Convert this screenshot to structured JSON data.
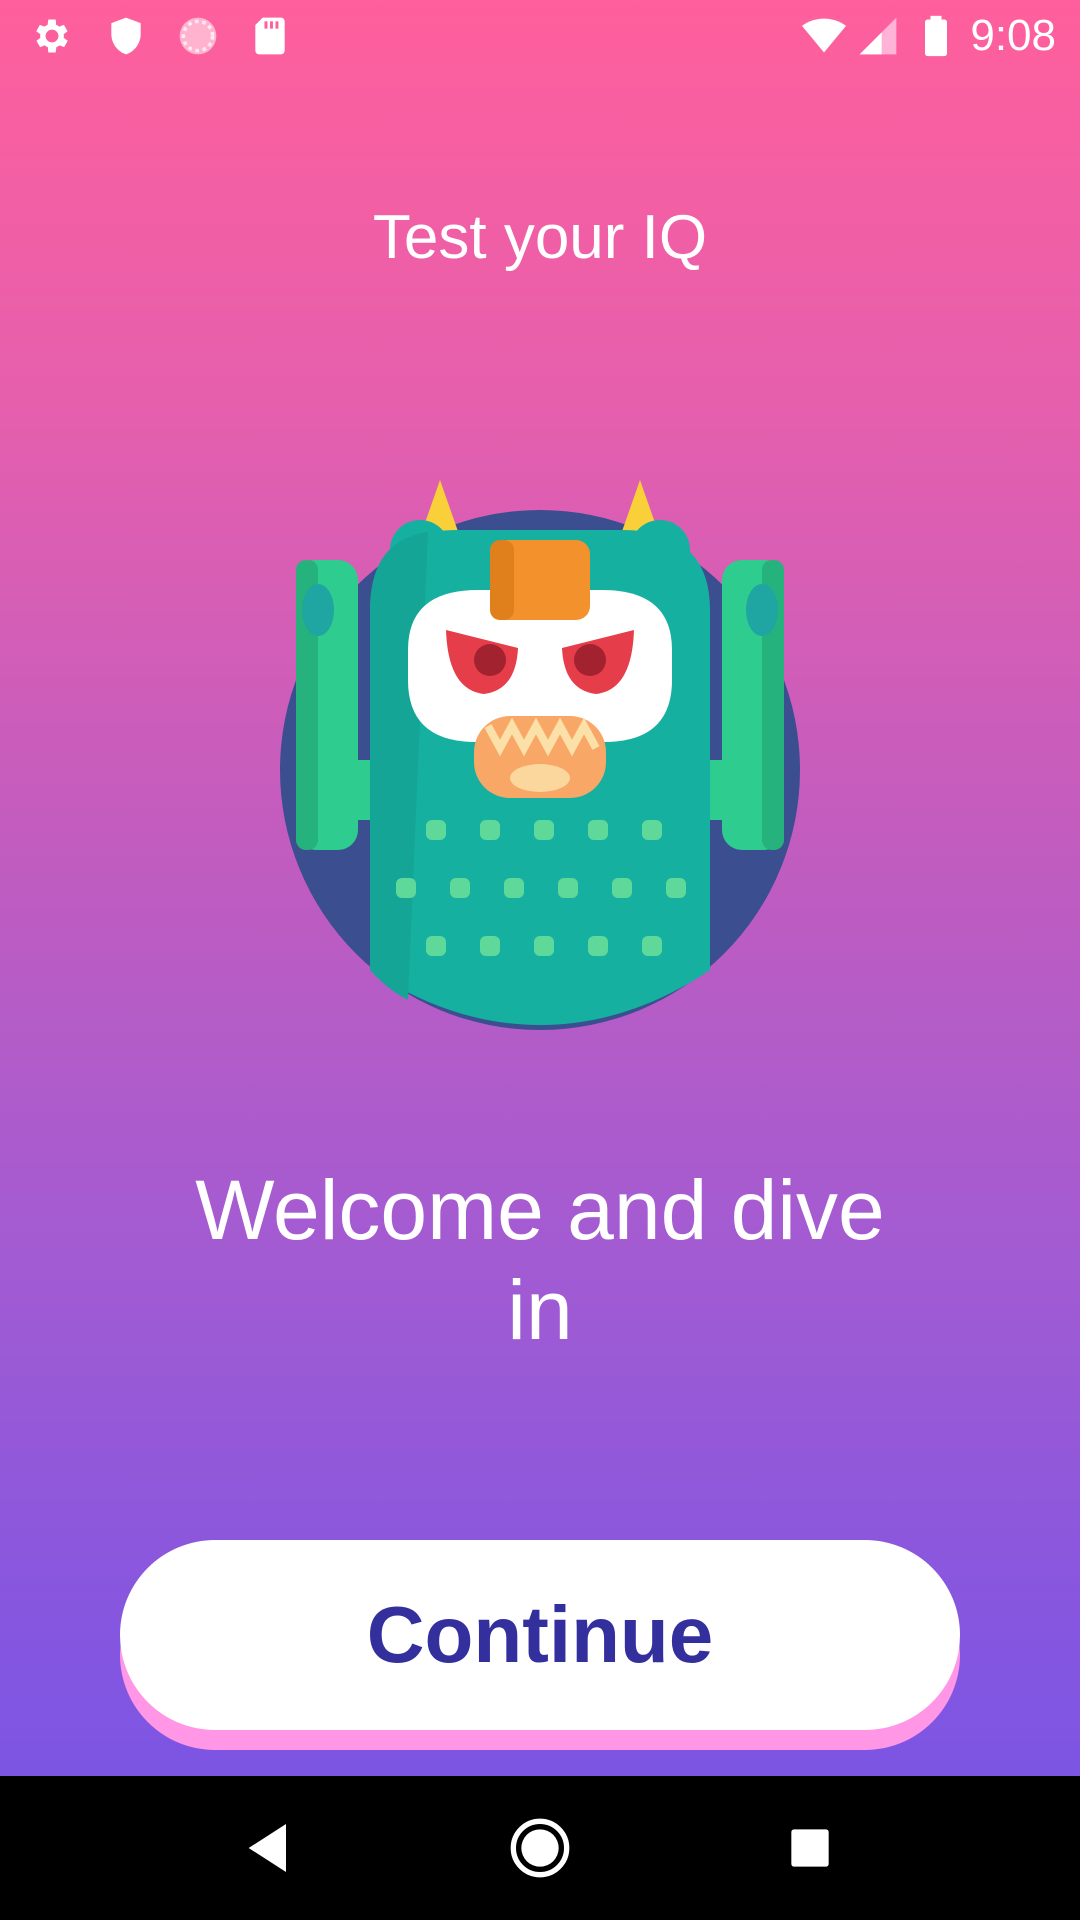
{
  "status_bar": {
    "time": "9:08",
    "left_icons": [
      "gear-icon",
      "shield-icon",
      "loading-circle-icon",
      "sd-card-icon"
    ],
    "right_icons": [
      "wifi-icon",
      "cellular-signal-icon",
      "battery-icon"
    ]
  },
  "app": {
    "title": "Test your IQ",
    "mascot": "monster-mascot"
  },
  "welcome": {
    "line1": "Welcome and dive",
    "line2": "in"
  },
  "continue_button": {
    "label": "Continue"
  },
  "nav_bar": {
    "buttons": [
      "back-icon",
      "home-icon",
      "recents-icon"
    ]
  },
  "colors": {
    "gradient_top": "#ff5f9c",
    "gradient_bottom": "#7454e6",
    "button_text": "#33309e",
    "button_shadow": "#ff96e6"
  }
}
